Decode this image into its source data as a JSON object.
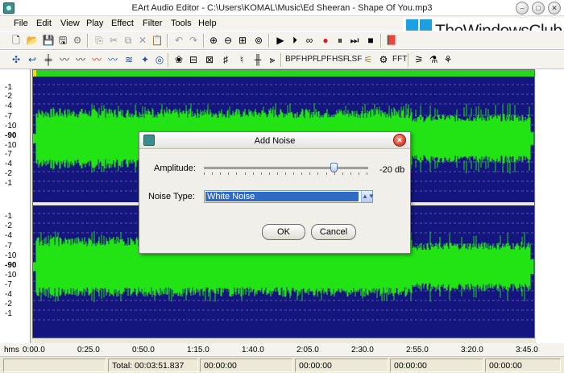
{
  "window": {
    "title": "EArt Audio Editor - C:\\Users\\KOMAL\\Music\\Ed Sheeran - Shape Of You.mp3"
  },
  "menu": [
    "File",
    "Edit",
    "View",
    "Play",
    "Effect",
    "Filter",
    "Tools",
    "Help"
  ],
  "filter_buttons": [
    "BPF",
    "HPF",
    "LPF",
    "HSF",
    "LSF",
    "FFT"
  ],
  "watermark": {
    "text": "TheWindowsClub",
    "logo_color": "#1ba1e2"
  },
  "ruler_labels": {
    "top_channel": [
      "-1",
      "-2",
      "-4",
      "-7",
      "-10",
      "-90",
      "-10",
      "-7",
      "-4",
      "-2",
      "-1"
    ],
    "bottom_channel": [
      "-1",
      "-2",
      "-4",
      "-7",
      "-10",
      "-90",
      "-10",
      "-7",
      "-4",
      "-2",
      "-1"
    ]
  },
  "timeline": {
    "unit": "hms",
    "ticks": [
      "0:00.0",
      "0:25.0",
      "0:50.0",
      "1:15.0",
      "1:40.0",
      "2:05.0",
      "2:30.0",
      "2:55.0",
      "3:20.0",
      "3:45.0"
    ]
  },
  "status": {
    "total": "Total: 00:03:51.837",
    "cells": [
      "00:00:00",
      "00:00:00",
      "00:00:00",
      "00:00:00"
    ]
  },
  "dialog": {
    "title": "Add Noise",
    "amplitude_label": "Amplitude:",
    "amplitude_value": "-20 db",
    "amplitude_fraction": 0.79,
    "noise_type_label": "Noise Type:",
    "noise_type_value": "White Noise",
    "ok_label": "OK",
    "cancel_label": "Cancel"
  },
  "colors": {
    "waveform": "#22e414",
    "wave_background": "#15157e",
    "selection_bar": "#22d81c"
  }
}
